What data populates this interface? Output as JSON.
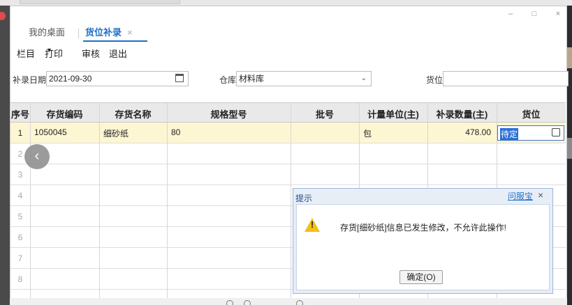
{
  "window": {
    "minimize_glyph": "–",
    "maximize_glyph": "□",
    "close_glyph": "×"
  },
  "tabs": [
    {
      "label": "我的桌面",
      "active": false
    },
    {
      "label": "货位补录",
      "active": true,
      "close_glyph": "×"
    }
  ],
  "menu": [
    "栏目",
    "打印",
    "审核",
    "退出"
  ],
  "form": {
    "date_label": "补录日期",
    "date_value": "2021-09-30",
    "warehouse_label": "仓库",
    "warehouse_value": "材料库",
    "location_label": "货位",
    "location_value": ""
  },
  "table": {
    "headers": [
      "序号",
      "存货编码",
      "存货名称",
      "规格型号",
      "批号",
      "计量单位(主)",
      "补录数量(主)",
      "货位"
    ],
    "rows": [
      {
        "no": "1",
        "code": "1050045",
        "name": "细砂纸",
        "spec": "80",
        "batch": "",
        "unit": "包",
        "qty": "478.00",
        "location": "待定"
      },
      {
        "no": "2"
      },
      {
        "no": "3"
      },
      {
        "no": "4"
      },
      {
        "no": "5"
      },
      {
        "no": "6"
      },
      {
        "no": "7"
      },
      {
        "no": "8"
      }
    ]
  },
  "nav_back_glyph": "‹",
  "dialog": {
    "title": "提示",
    "help_link": "问服宝",
    "close_glyph": "×",
    "message": "存货[细砂纸]信息已发生修改，不允许此操作!",
    "ok_label": "确定(O)"
  },
  "colors": {
    "accent": "#1e6fc8",
    "selected_row": "#fdf6d3",
    "warning": "#f2c118"
  }
}
